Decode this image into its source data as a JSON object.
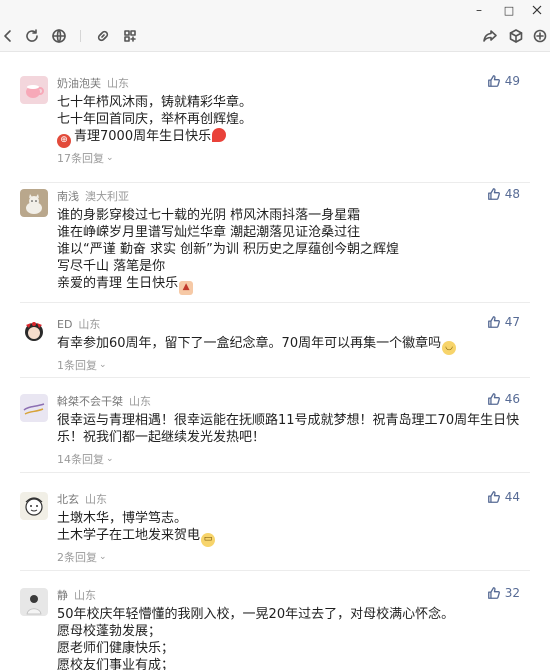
{
  "window": {
    "minimize_glyph": "–",
    "maximize_glyph": "□"
  },
  "comments": [
    {
      "user": "奶油泡芙",
      "location": "山东",
      "likes": "49",
      "avatar_icon": "pink-cup-avatar",
      "avatar_bg": "#f3d6dc",
      "lines": [
        "七十年栉风沐雨，铸就精彩华章。",
        "七十年回首同庆，举杯再创辉煌。",
        "青理7000周年生日快乐"
      ],
      "replies": "17条回复"
    },
    {
      "user": "南浅",
      "location": "澳大利亚",
      "likes": "48",
      "avatar_icon": "cat-avatar",
      "avatar_bg": "#b9a78c",
      "lines": [
        "谁的身影穿梭过七十载的光阴 栉风沐雨抖落一身星霜",
        "谁在峥嵘岁月里谱写灿烂华章 潮起潮落见证沧桑过往",
        "谁以“严谨 勤奋 求实 创新”为训 积历史之厚蕴创今朝之辉煌",
        "写尽千山 落笔是你",
        "亲爱的青理 生日快乐"
      ],
      "replies": ""
    },
    {
      "user": "ED",
      "location": "山东",
      "likes": "47",
      "avatar_icon": "anime-avatar",
      "avatar_bg": "#2a2a2a",
      "lines": [
        "有幸参加60周年，留下了一盒纪念章。70周年可以再集一个徽章吗"
      ],
      "replies": "1条回复"
    },
    {
      "user": "斡桀不会干桀",
      "location": "山东",
      "likes": "46",
      "avatar_icon": "sketch-avatar",
      "avatar_bg": "#e9e6f2",
      "lines": [
        "很幸运与青理相遇！很幸运能在抚顺路11号成就梦想！祝青岛理工70周年生日快",
        "乐！祝我们都一起继续发光发热吧！"
      ],
      "replies": "14条回复"
    },
    {
      "user": "北玄",
      "location": "山东",
      "likes": "44",
      "avatar_icon": "cartoon-avatar",
      "avatar_bg": "#f1efe6",
      "lines": [
        "土墩木华，博学笃志。",
        "土木学子在工地发来贺电"
      ],
      "replies": "2条回复"
    },
    {
      "user": "静",
      "location": "山东",
      "likes": "32",
      "avatar_icon": "portrait-avatar",
      "avatar_bg": "#e7e7e7",
      "lines": [
        "50年校庆年轻懵懂的我刚入校，一晃20年过去了，对母校满心怀念。",
        "愿母校蓬勃发展；",
        "愿老师们健康快乐；",
        "愿校友们事业有成；"
      ],
      "replies": ""
    }
  ]
}
